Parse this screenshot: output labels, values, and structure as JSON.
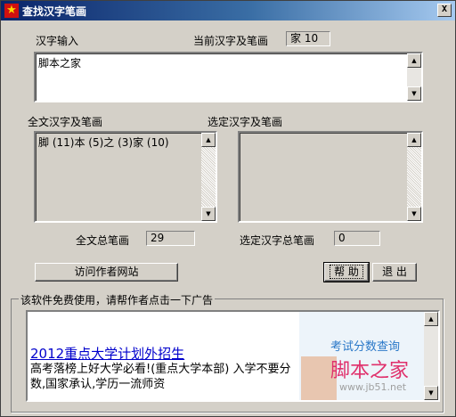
{
  "window": {
    "title": "查找汉字笔画",
    "close_label": "X"
  },
  "input": {
    "label": "汉字输入",
    "value": "脚本之家"
  },
  "current": {
    "label": "当前汉字及笔画",
    "value": "家  10"
  },
  "all_text": {
    "label": "全文汉字及笔画",
    "content": "脚 (11)本 (5)之 (3)家 (10)"
  },
  "selected": {
    "label": "选定汉字及笔画",
    "content": ""
  },
  "totals": {
    "all_label": "全文总笔画",
    "all_value": "29",
    "selected_label": "选定汉字总笔画",
    "selected_value": "0"
  },
  "buttons": {
    "visit_site": "访问作者网站",
    "help": "帮 助",
    "exit": "退 出"
  },
  "ad": {
    "group_title": "该软件免费使用，请帮作者点击一下广告",
    "link": "2012重点大学计划外招生",
    "desc": "高考落榜上好大学必看!(重点大学本部) 入学不要分数,国家承认,学历一流师资",
    "side_title": "考试分数查询",
    "watermark": "脚本之家",
    "watermark_sub": "www.jb51.net"
  }
}
